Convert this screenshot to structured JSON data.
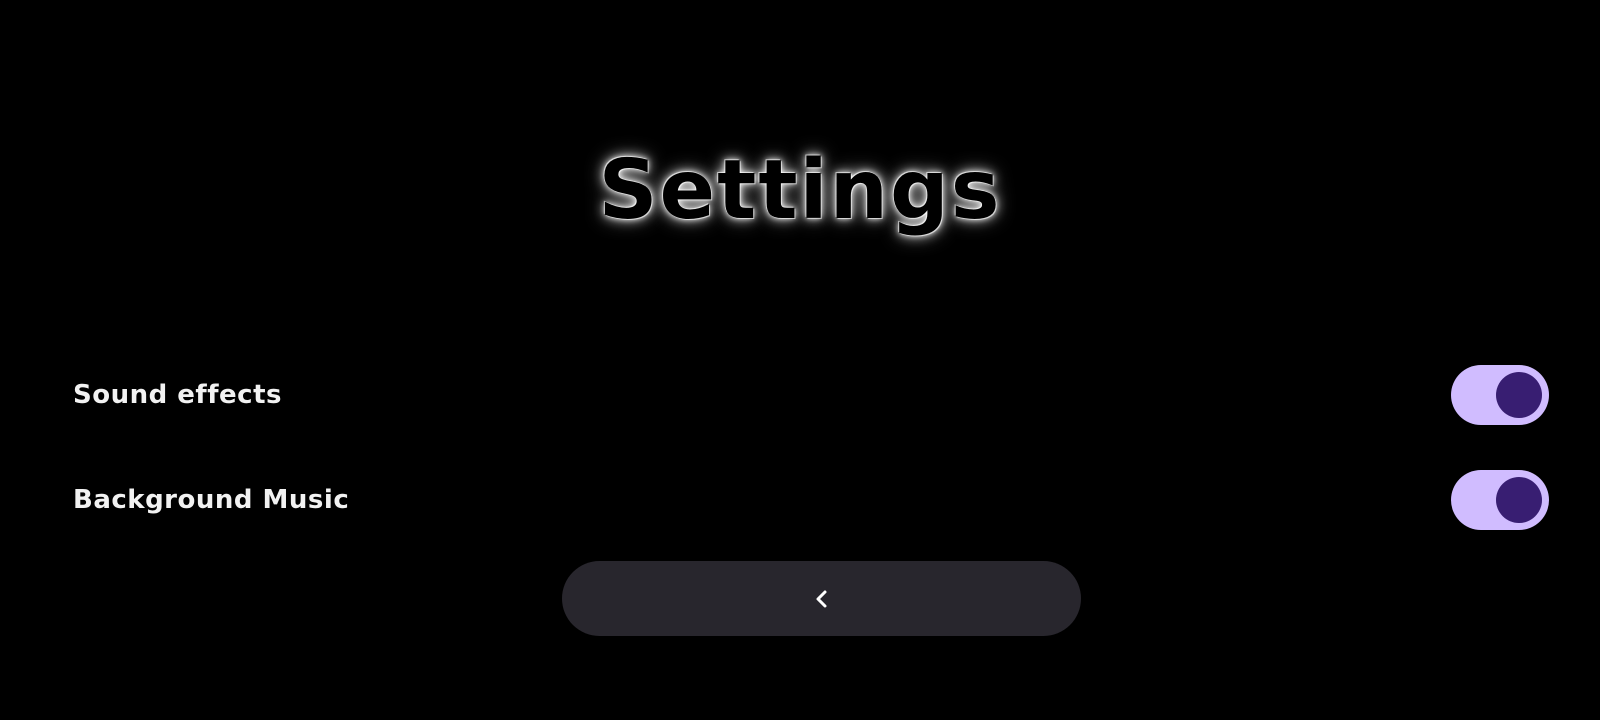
{
  "header": {
    "title": "Settings"
  },
  "settings": [
    {
      "label": "Sound effects",
      "enabled": true
    },
    {
      "label": "Background Music",
      "enabled": true
    }
  ],
  "footer": {
    "back_icon": "chevron-left-icon"
  },
  "colors": {
    "background": "#000000",
    "toggle_track": "#d0bcff",
    "toggle_thumb": "#381e72",
    "button_bg": "#28262d",
    "label_text": "#f2f2f2"
  }
}
